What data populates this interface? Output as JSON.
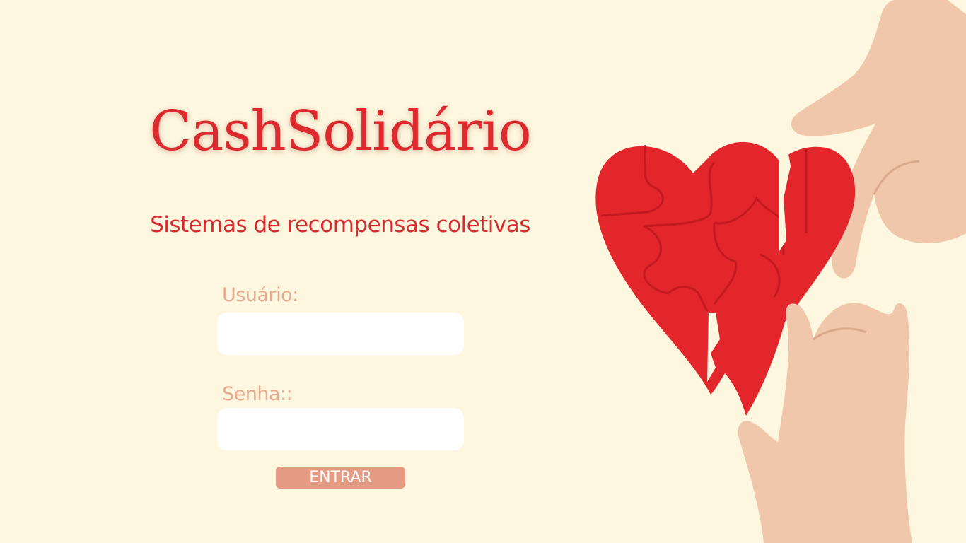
{
  "brand": {
    "title": "CashSolidário",
    "subtitle": "Sistemas de recompensas coletivas"
  },
  "login": {
    "username_label": "Usuário:",
    "username_value": "",
    "password_label": "Senha::",
    "password_value": "",
    "submit_label": "ENTRAR"
  },
  "illustration": {
    "icon": "heart-puzzle-hands-icon",
    "heart_color": "#e3262c",
    "skin_color": "#f1c7ac"
  },
  "colors": {
    "background": "#fef7df",
    "title": "#dc2a2e",
    "label": "#e9a98e",
    "button": "#e59b83"
  }
}
